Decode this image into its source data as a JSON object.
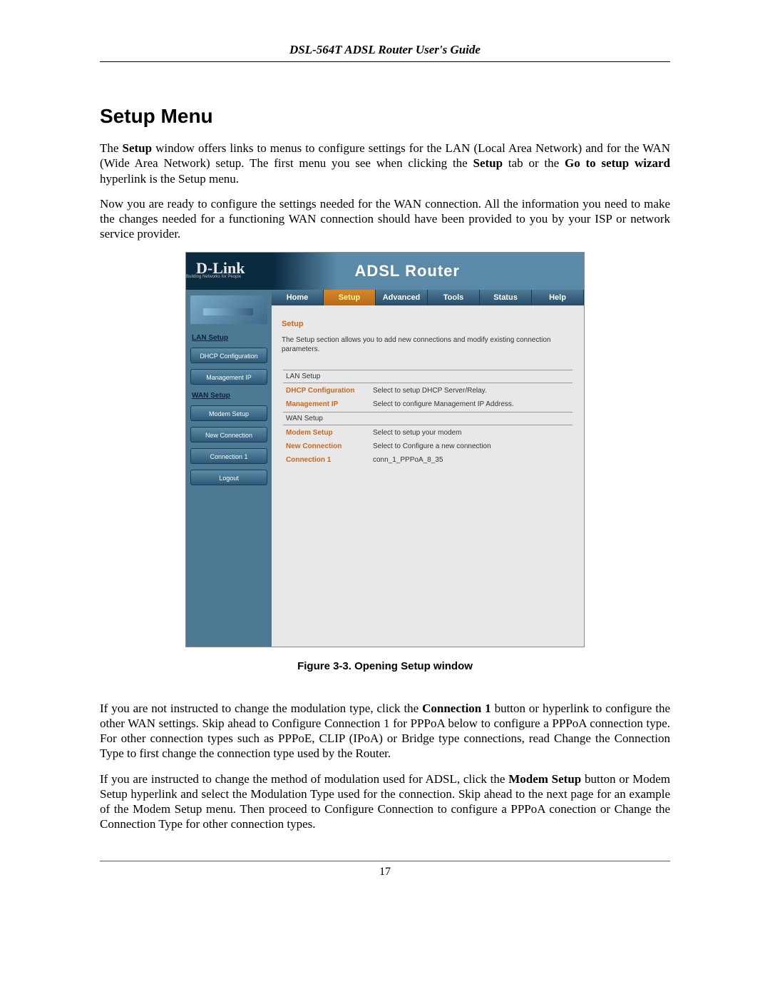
{
  "doc": {
    "header": "DSL-564T ADSL Router User's Guide",
    "section_title": "Setup Menu",
    "p1_a": "The ",
    "p1_b": "Setup",
    "p1_c": " window offers links to menus to configure settings for the LAN (Local Area Network) and for the WAN (Wide Area Network) setup. The first menu you see when clicking the ",
    "p1_d": "Setup",
    "p1_e": " tab or the ",
    "p1_f": "Go to setup wizard",
    "p1_g": " hyperlink is the Setup menu.",
    "p2": "Now you are ready to configure the settings needed for the WAN connection. All the information you need to make the changes needed for a functioning WAN connection should have been provided to you by your ISP or network service provider.",
    "figure_caption": "Figure 3-3. Opening Setup window",
    "p3_a": "If you are not instructed to change the modulation type, click the ",
    "p3_b": "Connection 1",
    "p3_c": " button or hyperlink to configure the other WAN settings. Skip ahead to Configure Connection 1 for PPPoA below to configure a PPPoA connection type. For other connection types such as PPPoE, CLIP (IPoA) or Bridge type connections, read Change the Connection Type to first change the connection type used by the Router.",
    "p4_a": "If you are instructed to change the method of modulation used for ADSL, click the ",
    "p4_b": "Modem Setup",
    "p4_c": " button or Modem Setup hyperlink and select the Modulation Type used for the connection. Skip ahead to the next page for an example of the Modem Setup menu. Then proceed to Configure Connection to configure a PPPoA conection or Change the Connection Type for other connection types.",
    "page_number": "17"
  },
  "router": {
    "logo": "D-Link",
    "tagline": "Building Networks for People",
    "title": "ADSL Router",
    "tabs": [
      "Home",
      "Setup",
      "Advanced",
      "Tools",
      "Status",
      "Help"
    ],
    "active_tab": "Setup",
    "sidebar": {
      "lan_heading": "LAN Setup",
      "wan_heading": "WAN Setup",
      "dhcp": "DHCP Configuration",
      "mgmt": "Management IP",
      "modem": "Modem Setup",
      "newconn": "New Connection",
      "conn1": "Connection 1",
      "logout": "Logout"
    },
    "content": {
      "heading": "Setup",
      "intro": "The Setup section allows you to add new connections and modify existing connection parameters.",
      "lan_group": "LAN Setup",
      "lan_rows": [
        {
          "link": "DHCP Configuration",
          "desc": "Select to setup DHCP Server/Relay."
        },
        {
          "link": "Management IP",
          "desc": "Select to configure Management IP Address."
        }
      ],
      "wan_group": "WAN Setup",
      "wan_rows": [
        {
          "link": "Modem Setup",
          "desc": "Select to setup your modem"
        },
        {
          "link": "New Connection",
          "desc": "Select to Configure a new connection"
        },
        {
          "link": "Connection 1",
          "desc": "conn_1_PPPoA_8_35"
        }
      ]
    }
  }
}
